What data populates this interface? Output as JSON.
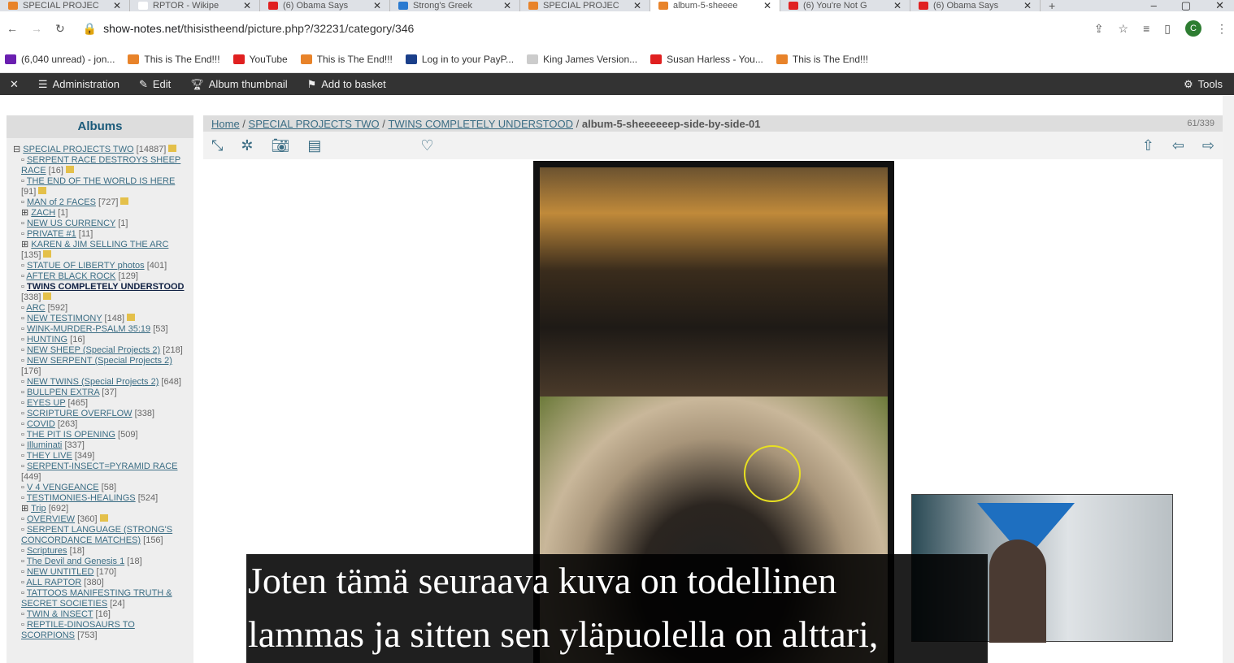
{
  "tabs": [
    {
      "title": "SPECIAL PROJEC",
      "color": "#e8832a"
    },
    {
      "title": "RPTOR - Wikipe",
      "color": "#ffffff"
    },
    {
      "title": "(6) Obama Says",
      "color": "#e02020"
    },
    {
      "title": "Strong's Greek",
      "color": "#2a7ad0"
    },
    {
      "title": "SPECIAL PROJEC",
      "color": "#e8832a"
    },
    {
      "title": "album-5-sheeee",
      "color": "#e8832a",
      "active": true
    },
    {
      "title": "(6) You're Not G",
      "color": "#e02020"
    },
    {
      "title": "(6) Obama Says",
      "color": "#e02020"
    }
  ],
  "address": {
    "host": "show-notes.net",
    "path": "/thisistheend/picture.php?/32231/category/346",
    "avatar": "C"
  },
  "bookmarks": [
    {
      "label": "(6,040 unread) - jon...",
      "color": "#6a1fb0"
    },
    {
      "label": "This is The End!!!",
      "color": "#e8832a"
    },
    {
      "label": "YouTube",
      "color": "#e02020"
    },
    {
      "label": "This is The End!!!",
      "color": "#e8832a"
    },
    {
      "label": "Log in to your PayP...",
      "color": "#1a3f8a"
    },
    {
      "label": "King James Version...",
      "color": "#cccccc"
    },
    {
      "label": "Susan Harless - You...",
      "color": "#e02020"
    },
    {
      "label": "This is The End!!!",
      "color": "#e8832a"
    }
  ],
  "adminbar": {
    "close": "✕",
    "administration": "Administration",
    "edit": "Edit",
    "album_thumbnail": "Album thumbnail",
    "add_to_basket": "Add to basket",
    "tools": "Tools"
  },
  "albums": {
    "title": "Albums",
    "items": [
      {
        "l": "SPECIAL PROJECTS TWO",
        "c": "[14887]",
        "e": "⊟",
        "i": 1
      },
      {
        "l": "SERPENT RACE DESTROYS SHEEP RACE",
        "c": "[16]",
        "e": "▫",
        "i": 1
      },
      {
        "l": "THE END OF THE WORLD IS HERE",
        "c": "[91]",
        "e": "▫",
        "i": 1
      },
      {
        "l": "MAN of 2 FACES",
        "c": "[727]",
        "e": "▫",
        "i": 1
      },
      {
        "l": "ZACH",
        "c": "[1]",
        "e": "⊞"
      },
      {
        "l": "NEW US CURRENCY",
        "c": "[1]",
        "e": "▫"
      },
      {
        "l": "PRIVATE #1",
        "c": "[11]",
        "e": "▫"
      },
      {
        "l": "KAREN & JIM SELLING THE ARC",
        "c": "[135]",
        "e": "⊞",
        "i": 1
      },
      {
        "l": "STATUE OF LIBERTY photos",
        "c": "[401]",
        "e": "▫"
      },
      {
        "l": "AFTER BLACK ROCK",
        "c": "[129]",
        "e": "▫"
      },
      {
        "l": "TWINS COMPLETELY UNDERSTOOD",
        "c": "[338]",
        "e": "▫",
        "i": 1,
        "b": 1
      },
      {
        "l": "ARC",
        "c": "[592]",
        "e": "▫"
      },
      {
        "l": "NEW TESTIMONY",
        "c": "[148]",
        "e": "▫",
        "i": 1
      },
      {
        "l": "WINK-MURDER-PSALM 35:19",
        "c": "[53]",
        "e": "▫"
      },
      {
        "l": "HUNTING",
        "c": "[16]",
        "e": "▫"
      },
      {
        "l": "NEW SHEEP (Special Projects 2)",
        "c": "[218]",
        "e": "▫"
      },
      {
        "l": "NEW SERPENT (Special Projects 2)",
        "c": "[176]",
        "e": "▫"
      },
      {
        "l": "NEW TWINS (Special Projects 2)",
        "c": "[648]",
        "e": "▫"
      },
      {
        "l": "BULLPEN EXTRA",
        "c": "[37]",
        "e": "▫"
      },
      {
        "l": "EYES UP",
        "c": "[465]",
        "e": "▫"
      },
      {
        "l": "SCRIPTURE OVERFLOW",
        "c": "[338]",
        "e": "▫"
      },
      {
        "l": "COVID",
        "c": "[263]",
        "e": "▫"
      },
      {
        "l": "THE PIT IS OPENING",
        "c": "[509]",
        "e": "▫"
      },
      {
        "l": "Illuminati",
        "c": "[337]",
        "e": "▫"
      },
      {
        "l": "THEY LIVE",
        "c": "[349]",
        "e": "▫"
      },
      {
        "l": "SERPENT-INSECT=PYRAMID RACE",
        "c": "[449]",
        "e": "▫"
      },
      {
        "l": "V 4 VENGEANCE",
        "c": "[58]",
        "e": "▫"
      },
      {
        "l": "TESTIMONIES-HEALINGS",
        "c": "[524]",
        "e": "▫"
      },
      {
        "l": "Trip",
        "c": "[692]",
        "e": "⊞"
      },
      {
        "l": "OVERVIEW",
        "c": "[360]",
        "e": "▫",
        "i": 1
      },
      {
        "l": "SERPENT LANGUAGE (STRONG'S CONCORDANCE MATCHES)",
        "c": "[156]",
        "e": "▫"
      },
      {
        "l": "Scriptures",
        "c": "[18]",
        "e": "▫"
      },
      {
        "l": "The Devil and Genesis 1",
        "c": "[18]",
        "e": "▫"
      },
      {
        "l": "NEW UNTITLED",
        "c": "[170]",
        "e": "▫"
      },
      {
        "l": "ALL RAPTOR",
        "c": "[380]",
        "e": "▫"
      },
      {
        "l": "TATTOOS MANIFESTING TRUTH & SECRET SOCIETIES",
        "c": "[24]",
        "e": "▫"
      },
      {
        "l": "TWIN & INSECT",
        "c": "[16]",
        "e": "▫"
      },
      {
        "l": "REPTILE-DINOSAURS TO SCORPIONS",
        "c": "[753]",
        "e": "▫"
      }
    ]
  },
  "breadcrumb": {
    "home": "Home",
    "parent": "SPECIAL PROJECTS TWO",
    "album": "TWINS COMPLETELY UNDERSTOOD",
    "current": "album-5-sheeeeeep-side-by-side-01",
    "counter": "61/339"
  },
  "subtitle": {
    "line1": "Joten tämä seuraava kuva on todellinen",
    "line2": "lammas ja sitten sen yläpuolella on alttari,"
  }
}
